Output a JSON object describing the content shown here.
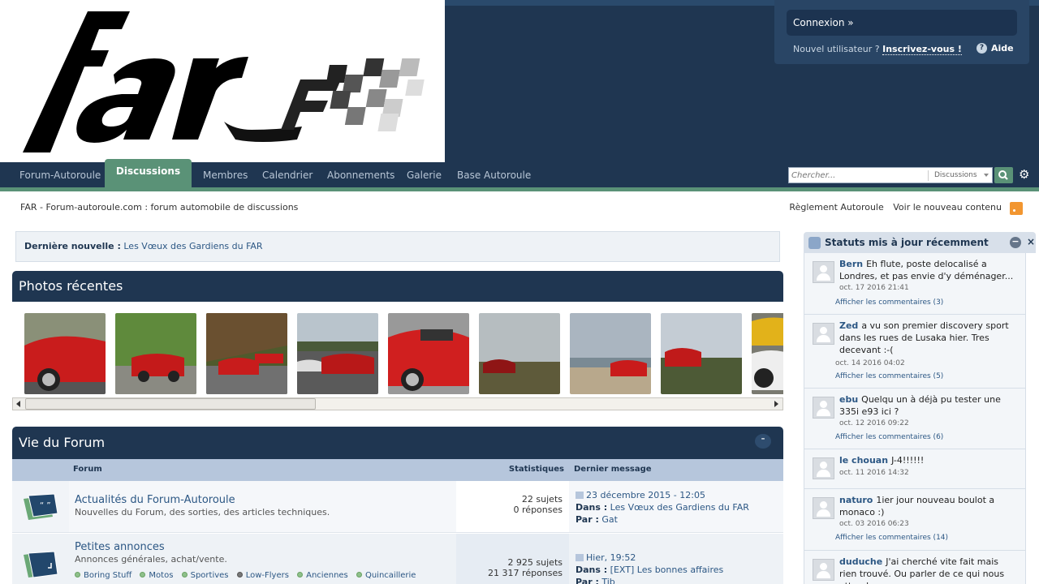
{
  "header": {
    "logo_text": "far",
    "login_label": "Connexion »",
    "new_user_text": "Nouvel utilisateur ?",
    "register_label": "Inscrivez-vous !",
    "help_label": "Aide"
  },
  "nav": {
    "items": [
      "Forum-Autoroule",
      "Discussions",
      "Membres",
      "Calendrier",
      "Abonnements",
      "Galerie",
      "Base Autoroule"
    ],
    "active": "Discussions",
    "search_placeholder": "Chercher...",
    "search_scope": "Discussions"
  },
  "breadcrumb": "FAR - Forum-autoroule.com : forum automobile de discussions",
  "top_links": [
    "Règlement Autoroule",
    "Voir le nouveau contenu"
  ],
  "news": {
    "label": "Dernière nouvelle :",
    "link": "Les Vœux des Gardiens du FAR"
  },
  "photos": {
    "title": "Photos récentes",
    "collapse": "-",
    "items": [
      "car-photo-1",
      "car-photo-2",
      "car-photo-3",
      "car-photo-4",
      "car-photo-5",
      "car-photo-6",
      "car-photo-7",
      "car-photo-8",
      "car-photo-9"
    ]
  },
  "forum": {
    "title": "Vie du Forum",
    "collapse": "-",
    "columns": {
      "forum": "Forum",
      "stats": "Statistiques",
      "last": "Dernier message"
    },
    "rows": [
      {
        "title": "Actualités du Forum-Autoroule",
        "desc": "Nouvelles du Forum, des sorties, des articles techniques.",
        "topics": "22 sujets",
        "replies": "0 réponses",
        "last_date": "23 décembre 2015 - 12:05",
        "in_label": "Dans :",
        "in_value": "Les Vœux des Gardiens du FAR",
        "by_label": "Par :",
        "by_value": "Gat"
      },
      {
        "title": "Petites annonces",
        "desc": "Annonces générales, achat/vente.",
        "topics": "2 925 sujets",
        "replies": "21 317 réponses",
        "last_date": "Hier, 19:52",
        "in_label": "Dans :",
        "in_value": "[EXT] Les bonnes affaires",
        "by_label": "Par :",
        "by_value": "Tib",
        "subforums": [
          "Boring Stuff",
          "Motos",
          "Sportives",
          "Low-Flyers",
          "Anciennes",
          "Quincaillerie"
        ]
      }
    ]
  },
  "sidebar": {
    "title": "Statuts mis à jour récemment",
    "close": "×",
    "minimize": "−",
    "statuses": [
      {
        "user": "Bern",
        "text": "Eh flute, poste delocalisé a Londres, et pas envie d'y déménager...",
        "date": "oct. 17 2016 21:41",
        "comments": "Afficher les commentaires (3)"
      },
      {
        "user": "Zed",
        "text": "a vu son premier discovery sport dans les rues de Lusaka hier. Tres decevant :-(",
        "date": "oct. 14 2016 04:02",
        "comments": "Afficher les commentaires (5)"
      },
      {
        "user": "ebu",
        "text": "Quelqu un à déjà pu tester une 335i e93 ici ?",
        "date": "oct. 12 2016 09:22",
        "comments": "Afficher les commentaires (6)"
      },
      {
        "user": "le chouan",
        "text": "J-4!!!!!!",
        "date": "oct. 11 2016 14:32",
        "comments": ""
      },
      {
        "user": "naturo",
        "text": "1ier jour nouveau boulot a monaco :)",
        "date": "oct. 03 2016 06:23",
        "comments": "Afficher les commentaires (14)"
      },
      {
        "user": "duduche",
        "text": "J'ai cherché vite fait mais rien trouvé. Ou parler de ce qui nous attend ...",
        "date": "",
        "comments": ""
      }
    ]
  },
  "colors": {
    "header_bg": "#1f3651",
    "accent_green": "#5a9277",
    "link": "#2c5784"
  }
}
